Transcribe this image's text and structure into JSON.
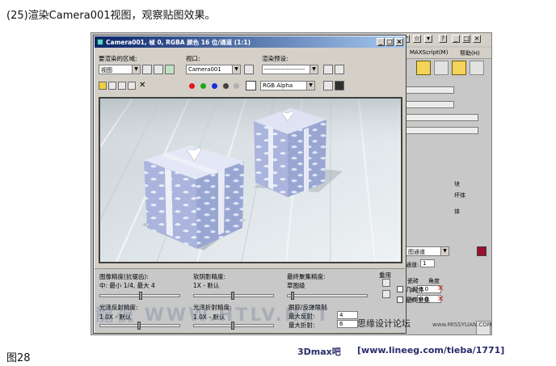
{
  "caption": "(25)渲染Camera001视图，观察贴图效果。",
  "figure_label": "图28",
  "max_app": {
    "menu": {
      "maxscript": "MAXScript(M)",
      "help": "帮助(H)"
    },
    "panel": {
      "channel_dropdown": "图通道",
      "channel_label": "通道:",
      "channel_value": "1",
      "tile_label": "瓷砖",
      "angle_label": "角度",
      "u_label": "U:",
      "u_value": "0.0",
      "v_label": "V:",
      "v_value": "0.0",
      "fragment_1": "块",
      "fragment_2": "坏体",
      "fragment_3": "体"
    }
  },
  "render_window": {
    "title": "Camera001, 帧 0, RGBA 颜色 16 位/通道 (1:1)",
    "area_label": "要渲染的区域:",
    "area_value": "视图",
    "viewport_label": "视口:",
    "viewport_value": "Camera001",
    "preset_label": "渲染预设:",
    "preset_value": "--------------------",
    "channel_value": "RGB Alpha",
    "colors": {
      "red": "#e01818",
      "green": "#18a818",
      "blue": "#1830e0",
      "swatch": "#ffffff"
    }
  },
  "bottom_panel": {
    "image_precision_label": "图像精度(抗锯齿):",
    "image_precision_value": "中: 最小 1/4, 最大 4",
    "soft_shadow_label": "软阴影精度:",
    "soft_shadow_value": "1X - 默认",
    "final_gather_label": "最终聚集精度:",
    "final_gather_value": "草图级",
    "reuse_label": "重用",
    "geometry_label": "几何体",
    "final_gather_reuse_label": "最终聚集",
    "glossy_reflection_label": "光泽反射精度:",
    "glossy_reflection_value": "1.0X - 默认",
    "glossy_refraction_label": "光泽折射精度:",
    "glossy_refraction_value": "1.0X - 默认",
    "trace_label": "跟踪/反弹限制",
    "max_reflection_label": "最大反射:",
    "max_reflection_value": "4",
    "max_refraction_label": "最大折射:",
    "max_refraction_value": "6"
  },
  "overlays": {
    "watermark": "思缘设计论坛",
    "watermark_site": "www.MISSYUAN.COM",
    "footer_brand": "3Dmax吧",
    "footer_url": "[www.lineeg.com/tieba/1771]",
    "faint_mark": "龍視  WWW.HTLV.NET"
  }
}
